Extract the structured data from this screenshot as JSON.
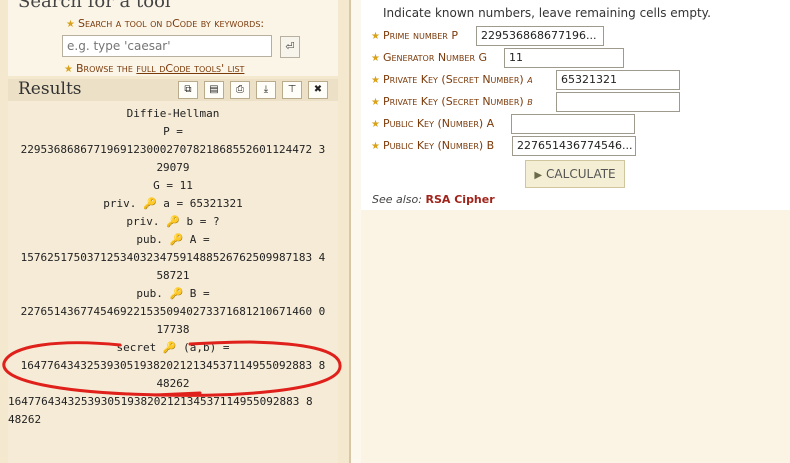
{
  "search": {
    "title": "Search for a tool",
    "label": "Search a tool on dCode by keywords:",
    "placeholder": "e.g. type 'caesar'",
    "go_icon": "return-icon",
    "browse_prefix": "Browse the ",
    "browse_link": "full dCode tools' list"
  },
  "results": {
    "title": "Results",
    "buttons": [
      "copy-icon",
      "save-icon",
      "print-icon",
      "download-icon",
      "pin-icon",
      "close-icon"
    ],
    "lines": [
      "Diffie-Hellman",
      "P =",
      "22953686867719691230002707821868552601124472 3",
      "29079",
      "G = 11",
      "priv. 🔑 a = 65321321",
      "priv. 🔑 b = ?",
      "pub. 🔑 A =",
      "15762517503712534032347591488526762509987183 4",
      "58721",
      "pub. 🔑 B =",
      "22765143677454692215350940273371681210671460 0",
      "17738",
      "secret 🔑 (a,b) =",
      "16477643432539305193820212134537114955092883 8",
      "48262",
      "16477643432539305193820212134537114955092883 8",
      "48262"
    ]
  },
  "form": {
    "instructions": "Indicate known numbers, leave remaining cells empty.",
    "prime_label": "Prime number P",
    "prime_value": "229536868677196...",
    "generator_label": "Generator Number G",
    "generator_value": "11",
    "priv_a_label": "Private Key (Secret Number)",
    "priv_a_var": "a",
    "priv_a_value": "65321321",
    "priv_b_label": "Private Key (Secret Number)",
    "priv_b_var": "b",
    "priv_b_value": "",
    "pub_a_label": "Public Key (Number) A",
    "pub_a_value": "",
    "pub_b_label": "Public Key (Number) B",
    "pub_b_value": "227651436774546...",
    "calculate_label": "CALCULATE",
    "see_also_prefix": "See also:",
    "see_also_link": "RSA Cipher"
  },
  "colors": {
    "accent_label": "#7b3a0a",
    "star": "#d9a21b",
    "link_red": "#a0241b",
    "annotation_red": "#e0201a"
  }
}
